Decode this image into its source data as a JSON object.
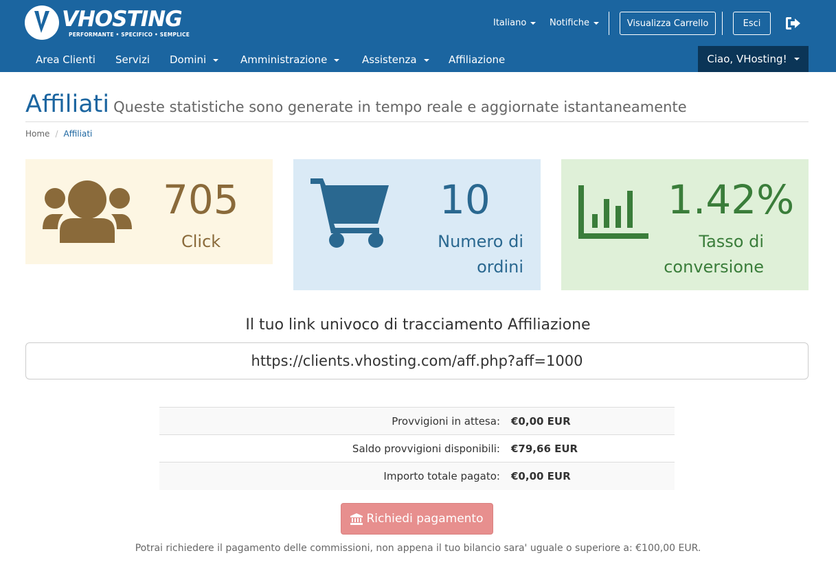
{
  "header": {
    "brand": "VHOSTING",
    "tagline": "PERFORMANTE • SPECIFICO • SEMPLICE",
    "language": "Italiano",
    "notifications": "Notifiche",
    "cart_button": "Visualizza Carrello",
    "logout_button": "Esci",
    "accent_color": "#1b65a0"
  },
  "nav": {
    "items": [
      {
        "label": "Area Clienti",
        "dropdown": false
      },
      {
        "label": "Servizi",
        "dropdown": false
      },
      {
        "label": "Domini",
        "dropdown": true
      },
      {
        "label": "Amministrazione",
        "dropdown": true
      },
      {
        "label": "Assistenza",
        "dropdown": true
      },
      {
        "label": "Affiliazione",
        "dropdown": false
      }
    ],
    "user_menu": "Ciao, VHosting!"
  },
  "page": {
    "title": "Affiliati",
    "subtitle": "Queste statistiche sono generate in tempo reale e aggiornate istantaneamente",
    "breadcrumb": [
      "Home",
      "Affiliati"
    ]
  },
  "stats": {
    "clicks": {
      "value": "705",
      "label": "Click",
      "icon": "users-icon"
    },
    "orders": {
      "value": "10",
      "label": "Numero di ordini",
      "icon": "shopping-cart-icon"
    },
    "conversion": {
      "value": "1.42%",
      "label": "Tasso di conversione",
      "icon": "bar-chart-icon"
    }
  },
  "referral": {
    "heading": "Il tuo link univoco di tracciamento Affiliazione",
    "link": "https://clients.vhosting.com/aff.php?aff=1000"
  },
  "commissions": [
    {
      "label": "Provvigioni in attesa:",
      "value": "€0,00 EUR"
    },
    {
      "label": "Saldo provvigioni disponibili:",
      "value": "€79,66 EUR"
    },
    {
      "label": "Importo totale pagato:",
      "value": "€0,00 EUR"
    }
  ],
  "payout": {
    "button": "Richiedi pagamento",
    "note": "Potrai richiedere il pagamento delle commissioni, non appena il tuo bilancio sara' uguale o superiore a: €100,00 EUR."
  }
}
